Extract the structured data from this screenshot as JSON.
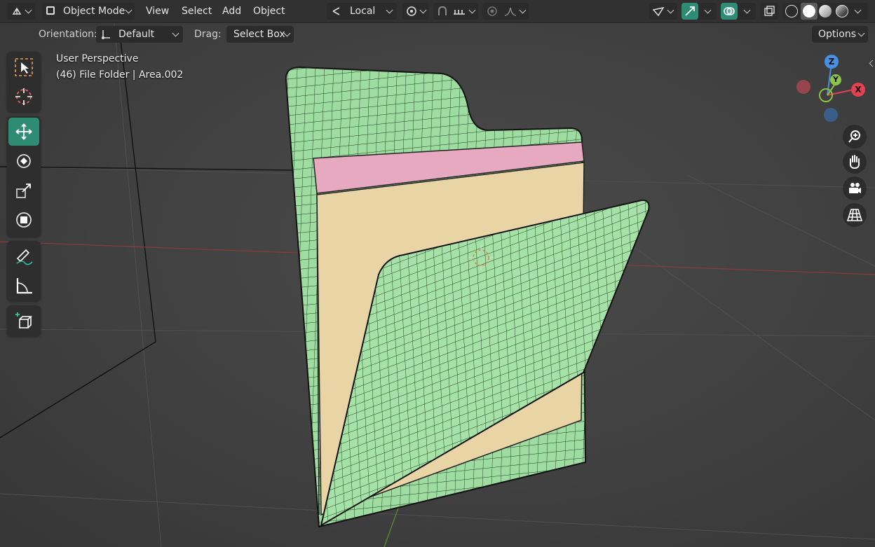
{
  "header": {
    "editor_type_icon": "editor-type-icon",
    "mode_label": "Object Mode",
    "menus": [
      "View",
      "Select",
      "Add",
      "Object"
    ],
    "transform_pivot_label": "Local",
    "options_label": "Options"
  },
  "tool_settings": {
    "orientation_label": "Orientation:",
    "orientation_value": "Default",
    "drag_label": "Drag:",
    "drag_value": "Select Box"
  },
  "overlay": {
    "view_name": "User Perspective",
    "object_info": "(46) File Folder | Area.002"
  },
  "gizmo": {
    "x": "X",
    "y": "Y",
    "z": "Z"
  },
  "colors": {
    "accent_teal": "#2e8b74",
    "folder_green": "#a6e2a8",
    "paper_pink": "#e6a9c0",
    "paper_tan": "#e8d4a4",
    "axis_x": "#e2414f",
    "axis_y": "#8bc34a",
    "axis_z": "#4a90e2"
  }
}
